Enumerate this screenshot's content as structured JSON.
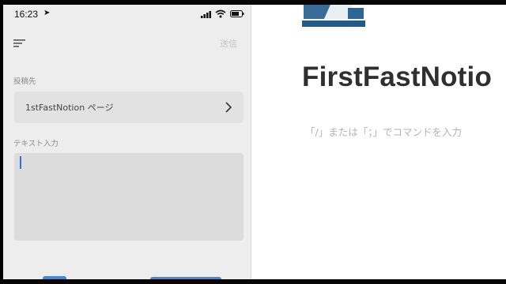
{
  "phone": {
    "status": {
      "time": "16:23"
    },
    "header": {
      "send_label": "送信"
    },
    "destination": {
      "label": "投稿先",
      "value": "1stFastNotion ページ"
    },
    "text_input": {
      "label": "テキスト入力",
      "value": ""
    }
  },
  "notion": {
    "title": "FirstFastNotio",
    "placeholder": "「/」または「；」でコマンドを入力"
  },
  "icons": {
    "location": "location-arrow-icon",
    "signal": "cellular-signal-icon",
    "wifi": "wifi-icon",
    "battery": "battery-icon",
    "filter": "filter-lines-icon",
    "chevron": "chevron-right-icon",
    "page": "page-cover-icon"
  },
  "colors": {
    "accent": "#4b86d6",
    "caret": "#3a6fd8"
  }
}
